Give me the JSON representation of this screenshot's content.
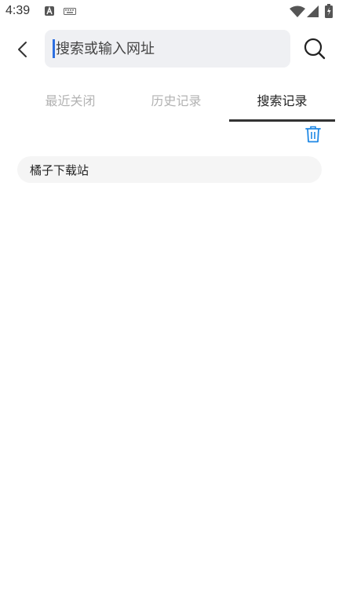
{
  "status_bar": {
    "time": "4:39",
    "icons": [
      "a-badge-icon",
      "keyboard-icon",
      "wifi-icon",
      "cell-signal-icon",
      "battery-icon"
    ]
  },
  "header": {
    "back_icon": "chevron-left-icon",
    "search": {
      "placeholder": "搜索或输入网址",
      "value": ""
    },
    "search_icon": "search-icon"
  },
  "tabs": [
    {
      "label": "最近关闭",
      "active": false
    },
    {
      "label": "历史记录",
      "active": false
    },
    {
      "label": "搜索记录",
      "active": true
    }
  ],
  "actions": {
    "clear_icon": "trash-icon",
    "accent_color": "#1e88e5"
  },
  "history": [
    {
      "label": "橘子下载站"
    }
  ]
}
